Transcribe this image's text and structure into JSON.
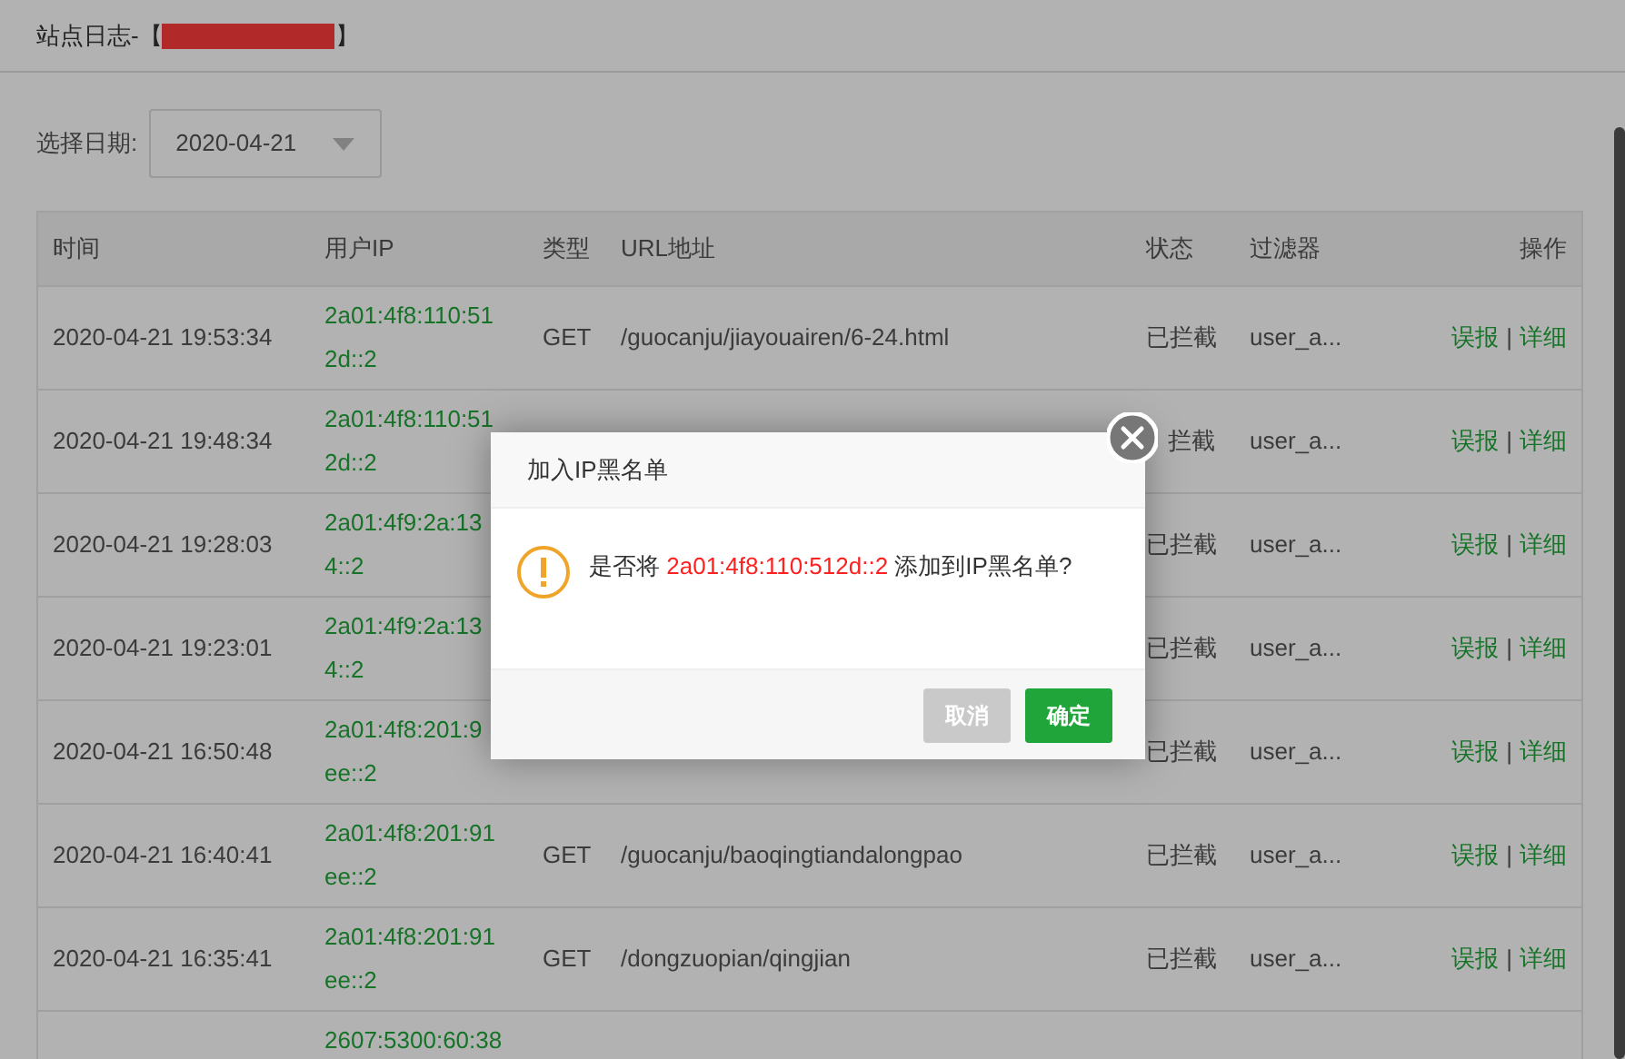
{
  "page": {
    "title": "站点日志-【",
    "title_end": "】",
    "date_label": "选择日期:",
    "date_value": "2020-04-21"
  },
  "table": {
    "columns": [
      "时间",
      "用户IP",
      "类型",
      "URL地址",
      "状态",
      "过滤器",
      "操作"
    ],
    "rows": [
      {
        "time": "2020-04-21 19:53:34",
        "ip": [
          "2a01:4f8:110:51",
          "2d::2"
        ],
        "type": "GET",
        "url": "/guocanju/jiayouairen/6-24.html",
        "status": "已拦截",
        "filter": "user_a...",
        "actions": [
          "误报",
          "|",
          "详细"
        ]
      },
      {
        "time": "2020-04-21 19:48:34",
        "ip": [
          "2a01:4f8:110:51",
          "2d::2"
        ],
        "status": "拦截",
        "filter": "user_a...",
        "actions": [
          "误报",
          "|",
          "详细"
        ]
      },
      {
        "time": "2020-04-21 19:28:03",
        "ip": [
          "2a01:4f9:2a:13",
          "4::2"
        ],
        "status": "已拦截",
        "filter": "user_a...",
        "actions": [
          "误报",
          "|",
          "详细"
        ]
      },
      {
        "time": "2020-04-21 19:23:01",
        "ip": [
          "2a01:4f9:2a:13",
          "4::2"
        ],
        "status": "已拦截",
        "filter": "user_a...",
        "actions": [
          "误报",
          "|",
          "详细"
        ]
      },
      {
        "time": "2020-04-21 16:50:48",
        "ip": [
          "2a01:4f8:201:9",
          "ee::2"
        ],
        "status": "已拦截",
        "filter": "user_a...",
        "actions": [
          "误报",
          "|",
          "详细"
        ]
      },
      {
        "time": "2020-04-21 16:40:41",
        "ip": [
          "2a01:4f8:201:91",
          "ee::2"
        ],
        "type": "GET",
        "url": "/guocanju/baoqingtiandalongpao",
        "status": "已拦截",
        "filter": "user_a...",
        "actions": [
          "误报",
          "|",
          "详细"
        ]
      },
      {
        "time": "2020-04-21 16:35:41",
        "ip": [
          "2a01:4f8:201:91",
          "ee::2"
        ],
        "type": "GET",
        "url": "/dongzuopian/qingjian",
        "status": "已拦截",
        "filter": "user_a...",
        "actions": [
          "误报",
          "|",
          "详细"
        ]
      },
      {
        "ip": [
          "2607:5300:60:38"
        ]
      }
    ]
  },
  "dialog": {
    "title": "加入IP黑名单",
    "message": "是否将 ",
    "ip": "2a01:4f8:110:512d::2",
    "message_end": " 添加到IP黑名单?",
    "buttons": [
      {
        "label": "取消",
        "kind": "cancel"
      },
      {
        "label": "确定",
        "kind": "confirm"
      }
    ]
  }
}
